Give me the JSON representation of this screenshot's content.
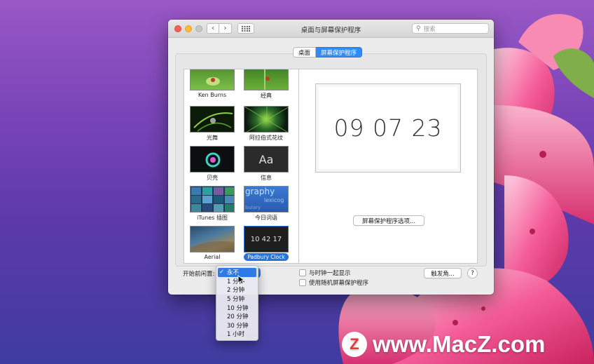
{
  "window": {
    "title": "桌面与屏幕保护程序"
  },
  "search": {
    "placeholder": "搜索"
  },
  "tabs": [
    {
      "label": "桌面"
    },
    {
      "label": "屏幕保护程序",
      "selected": true
    }
  ],
  "savers": [
    {
      "label": "Ken Burns",
      "thumb": "green-leaf"
    },
    {
      "label": "经典",
      "thumb": "green-ladybug"
    },
    {
      "label": "光舞",
      "thumb": "green-light-streaks"
    },
    {
      "label": "阿拉伯式花纹",
      "thumb": "green-swirl"
    },
    {
      "label": "贝壳",
      "thumb": "blue-shell"
    },
    {
      "label": "信息",
      "thumb": "aa-text",
      "thumb_text": "Aa"
    },
    {
      "label": "iTunes 插图",
      "thumb": "album-grid"
    },
    {
      "label": "今日词语",
      "thumb": "word-of-day",
      "thumb_text": "graphy",
      "thumb_text2": "lexicog",
      "thumb_text3": "bulary"
    },
    {
      "label": "Aerial",
      "thumb": "earth"
    },
    {
      "label": "Padbury Clock",
      "thumb": "clock",
      "thumb_text": "10 42 17",
      "selected": true
    }
  ],
  "preview": {
    "clock_text": "09 07 23"
  },
  "options_button": "屏幕保护程序选项...",
  "start_after_label": "开始前闲置:",
  "start_after_value": "永不",
  "show_clock_label": "与时钟一起显示",
  "random_label": "使用随机屏幕保护程序",
  "hot_corners_button": "触发角...",
  "help_label": "?",
  "menu_items": [
    "永不",
    "1 分钟",
    "2 分钟",
    "5 分钟",
    "10 分钟",
    "20 分钟",
    "30 分钟",
    "1 小时"
  ],
  "watermark": {
    "logo": "Z",
    "text": "www.MacZ.com"
  },
  "colors": {
    "accent": "#2f7ae4",
    "close": "#fe5f57",
    "minimize": "#febc2e"
  }
}
